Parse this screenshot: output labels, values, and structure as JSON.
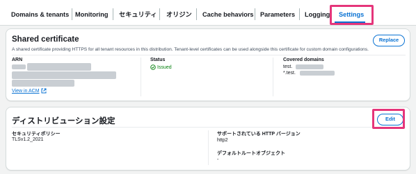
{
  "tabs": [
    {
      "label": "Domains & tenants"
    },
    {
      "label": "Monitoring"
    },
    {
      "label": "セキュリティ"
    },
    {
      "label": "オリジン"
    },
    {
      "label": "Cache behaviors"
    },
    {
      "label": "Parameters"
    },
    {
      "label": "Logging"
    },
    {
      "label": "Settings",
      "active": true
    }
  ],
  "certificate": {
    "title": "Shared certificate",
    "replace_label": "Replace",
    "description": "A shared certificate providing HTTPS for all tenant resources in this distribution. Tenant-level certificates can be used alongside this certificate for custom domain configurations.",
    "arn_label": "ARN",
    "view_acm_label": "View in ACM",
    "status_label": "Status",
    "status_value": "Issued",
    "covered_label": "Covered domains",
    "covered_domains": [
      "test.",
      "*.test."
    ]
  },
  "distribution_settings": {
    "title": "ディストリビューション設定",
    "edit_label": "Edit",
    "security_policy_label": "セキュリティポリシー",
    "security_policy_value": "TLSv1.2_2021",
    "http_version_label": "サポートされている HTTP バージョン",
    "http_version_value": "http2",
    "default_root_label": "デフォルトルートオブジェクト",
    "default_root_value": "-"
  },
  "colors": {
    "accent": "#0972d3",
    "highlight": "#e5357a",
    "success": "#037f0c"
  },
  "icons": {
    "status": "check-circle-icon",
    "external": "external-link-icon"
  }
}
